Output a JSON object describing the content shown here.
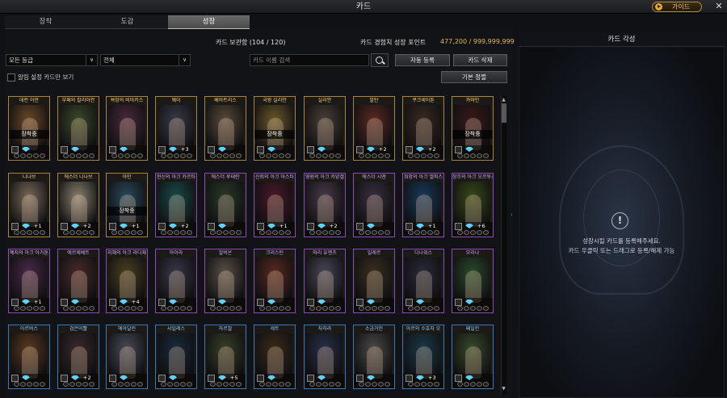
{
  "window": {
    "title": "카드",
    "guide_label": "가이드",
    "close_label": "✕"
  },
  "tabs": [
    {
      "label": "장착",
      "active": false
    },
    {
      "label": "도감",
      "active": false
    },
    {
      "label": "성장",
      "active": true
    }
  ],
  "header": {
    "storage_label": "카드 보관함 (104 / 120)",
    "exp_label": "카드 경험치 성장 포인트",
    "exp_value": "477,200 / 999,999,999"
  },
  "filters": {
    "grade_value": "모든 등급",
    "type_value": "전체",
    "search_placeholder": "카드 이름 검색",
    "auto_register_label": "자동 등록",
    "delete_label": "카드 삭제",
    "alert_only_label": "알림 설정 카드만 보기",
    "sort_label": "기본 정렬"
  },
  "equipped_label": "장착중",
  "cards": [
    {
      "name": "데런 아만",
      "rarity": "legend",
      "equipped": true,
      "plus": "",
      "art": "#6a4a2a"
    },
    {
      "name": "부패의 칼리아칸",
      "rarity": "legend",
      "equipped": false,
      "plus": "",
      "art": "#3d4a2a"
    },
    {
      "name": "욕망의 비아키스",
      "rarity": "legend",
      "equipped": false,
      "plus": "",
      "art": "#4a2a3d"
    },
    {
      "name": "웨이",
      "rarity": "legend",
      "equipped": false,
      "plus": "+3",
      "art": "#3a3a48"
    },
    {
      "name": "베아트리스",
      "rarity": "legend",
      "equipped": false,
      "plus": "",
      "art": "#5a4a3a"
    },
    {
      "name": "국왕 실리안",
      "rarity": "legend",
      "equipped": true,
      "plus": "",
      "art": "#6a5a2a"
    },
    {
      "name": "실리안",
      "rarity": "legend",
      "equipped": false,
      "plus": "",
      "art": "#4a4038"
    },
    {
      "name": "발탄",
      "rarity": "legend",
      "equipped": false,
      "plus": "+2",
      "art": "#5a2a22"
    },
    {
      "name": "쿠크세이튼",
      "rarity": "legend",
      "equipped": false,
      "plus": "+2",
      "art": "#3a2a22"
    },
    {
      "name": "카마인",
      "rarity": "legend",
      "equipped": true,
      "plus": "",
      "art": "#3a1a1a"
    },
    {
      "name": "니나브",
      "rarity": "legend",
      "equipped": false,
      "plus": "+1",
      "art": "#7a6a5a"
    },
    {
      "name": "에스더 니나브",
      "rarity": "legend",
      "equipped": false,
      "plus": "+2",
      "art": "#8a8070"
    },
    {
      "name": "아만",
      "rarity": "legend",
      "equipped": true,
      "plus": "+1",
      "art": "#2a4a5a"
    },
    {
      "name": "현신의 아크 카르타",
      "rarity": "purple",
      "equipped": false,
      "plus": "+2",
      "art": "#1a4a48"
    },
    {
      "name": "에스더 루테란",
      "rarity": "purple",
      "equipped": false,
      "plus": "",
      "art": "#2a3a2a"
    },
    {
      "name": "신뢰의 아크 아스타",
      "rarity": "purple",
      "equipped": false,
      "plus": "+1",
      "art": "#4a1a2a"
    },
    {
      "name": "영원의 아크 카양겔",
      "rarity": "purple",
      "equipped": false,
      "plus": "+2",
      "art": "#4a3a4a"
    },
    {
      "name": "에스더 시엔",
      "rarity": "purple",
      "equipped": false,
      "plus": "",
      "art": "#3a3040"
    },
    {
      "name": "희망의 아크 엘피스",
      "rarity": "purple",
      "equipped": false,
      "plus": "+1",
      "art": "#1a3a5a"
    },
    {
      "name": "창조의 아크 오르투스",
      "rarity": "purple",
      "equipped": false,
      "plus": "+6",
      "art": "#3a4a1a"
    },
    {
      "name": "예지의 아크 아가톤",
      "rarity": "purple",
      "equipped": false,
      "plus": "+1",
      "art": "#4a2a4a"
    },
    {
      "name": "에르제베트",
      "rarity": "purple",
      "equipped": false,
      "plus": "",
      "art": "#4a2a2a"
    },
    {
      "name": "지혜의 아크 라디체",
      "rarity": "purple",
      "equipped": false,
      "plus": "+4",
      "art": "#4a4020"
    },
    {
      "name": "아이라",
      "rarity": "purple",
      "equipped": false,
      "plus": "",
      "art": "#3a3848"
    },
    {
      "name": "알비온",
      "rarity": "purple",
      "equipped": false,
      "plus": "",
      "art": "#5a5048"
    },
    {
      "name": "크리스틴",
      "rarity": "purple",
      "equipped": false,
      "plus": "",
      "art": "#5a2a20"
    },
    {
      "name": "마리 유젠츠",
      "rarity": "purple",
      "equipped": false,
      "plus": "",
      "art": "#4a4858"
    },
    {
      "name": "일레르",
      "rarity": "purple",
      "equipped": false,
      "plus": "",
      "art": "#3a3020"
    },
    {
      "name": "디나위스",
      "rarity": "purple",
      "equipped": false,
      "plus": "",
      "art": "#2a2a3a"
    },
    {
      "name": "모리나",
      "rarity": "purple",
      "equipped": false,
      "plus": "",
      "art": "#2a4a2a"
    },
    {
      "name": "아르비스",
      "rarity": "blue",
      "equipped": false,
      "plus": "",
      "art": "#5a3a20"
    },
    {
      "name": "검은이빨",
      "rarity": "blue",
      "equipped": false,
      "plus": "+2",
      "art": "#3a2a2a"
    },
    {
      "name": "에아달린",
      "rarity": "blue",
      "equipped": false,
      "plus": "",
      "art": "#4a4a58"
    },
    {
      "name": "샤일레스",
      "rarity": "blue",
      "equipped": false,
      "plus": "",
      "art": "#1a2a3a"
    },
    {
      "name": "하르잘",
      "rarity": "blue",
      "equipped": false,
      "plus": "+5",
      "art": "#3a4028"
    },
    {
      "name": "세트",
      "rarity": "blue",
      "equipped": false,
      "plus": "",
      "art": "#3a2a1a"
    },
    {
      "name": "자하라",
      "rarity": "blue",
      "equipped": false,
      "plus": "",
      "art": "#2a3048"
    },
    {
      "name": "소금거인",
      "rarity": "blue",
      "equipped": false,
      "plus": "",
      "art": "#4a4a4a"
    },
    {
      "name": "아르의 수호자 오",
      "rarity": "blue",
      "equipped": false,
      "plus": "+3",
      "art": "#1a3a4a"
    },
    {
      "name": "페일린",
      "rarity": "blue",
      "equipped": false,
      "plus": "",
      "art": "#3a4a2a"
    }
  ],
  "awaken": {
    "title": "카드 각성",
    "message_line1": "성장시킬 카드를 등록해주세요.",
    "message_line2": "카드 우클릭 또는 드래그로 등록/해제 가능",
    "alert_icon": "!"
  },
  "colors": {
    "gold": "#a88436",
    "purple": "#8f4bb5",
    "blue": "#3a79b4",
    "exp": "#e6b84a"
  }
}
